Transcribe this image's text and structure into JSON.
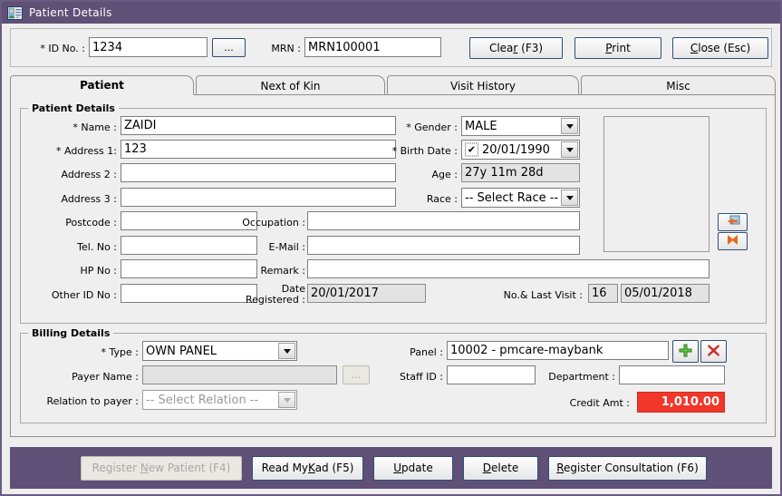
{
  "window": {
    "title": "Patient Details",
    "title_icon": "id-card-person-icon",
    "titlebar_color": "#5f5077",
    "accent_red": "#f0372a"
  },
  "header": {
    "id_no_label": "* ID No. :",
    "id_no_value": "1234",
    "browse_label": "...",
    "mrn_label": "MRN :",
    "mrn_value": "MRN100001",
    "buttons": [
      {
        "name": "clear-button",
        "label": "Clear (F3)",
        "underline": "r"
      },
      {
        "name": "print-button",
        "label": "Print",
        "underline": "P"
      },
      {
        "name": "close-button",
        "label": "Close (Esc)",
        "underline": "C"
      }
    ]
  },
  "tabs": [
    {
      "label": "Patient",
      "active": true
    },
    {
      "label": "Next of Kin",
      "active": false
    },
    {
      "label": "Visit History",
      "active": false
    },
    {
      "label": "Misc",
      "active": false
    }
  ],
  "patient_details": {
    "group_title": "Patient Details",
    "name_label": "* Name :",
    "name_value": "ZAIDI",
    "address1_label": "* Address 1:",
    "address1_value": "123",
    "address2_label": "Address 2 :",
    "address2_value": "",
    "address3_label": "Address 3 :",
    "address3_value": "",
    "postcode_label": "Postcode :",
    "postcode_value": "",
    "tel_label": "Tel. No :",
    "tel_value": "",
    "hp_label": "HP No :",
    "hp_value": "",
    "other_id_label": "Other ID No :",
    "other_id_value": "",
    "occupation_label": "Occupation :",
    "occupation_value": "",
    "email_label": "E-Mail :",
    "email_value": "",
    "remark_label": "Remark :",
    "remark_value": "",
    "date_registered_label_1": "Date",
    "date_registered_label_2": "Registered :",
    "date_registered_value": "20/01/2017",
    "gender_label": "* Gender :",
    "gender_value": "MALE",
    "birth_date_label": "* Birth Date :",
    "birth_date_value": "20/01/1990",
    "birth_date_checked": "✔",
    "age_label": "Age :",
    "age_value": "27y 11m 28d",
    "race_label": "Race :",
    "race_value": "-- Select Race --",
    "last_visit_label": "No.& Last  Visit :",
    "visit_count": "16",
    "last_visit_date": "05/01/2018",
    "photo_placeholder": "",
    "photo_load_icon": "load-photo-icon",
    "photo_clear_icon": "clear-photo-icon"
  },
  "billing_details": {
    "group_title": "Billing Details",
    "type_label": "* Type :",
    "type_value": "OWN PANEL",
    "payer_name_label": "Payer Name :",
    "payer_name_value": "",
    "payer_browse_label": "...",
    "relation_label": "Relation to payer :",
    "relation_value": "-- Select Relation --",
    "panel_label": "Panel :",
    "panel_value": "10002 - pmcare-maybank",
    "panel_add_icon": "add-plus-icon",
    "panel_remove_icon": "remove-cross-icon",
    "staff_id_label": "Staff ID :",
    "staff_id_value": "",
    "department_label": "Department :",
    "department_value": "",
    "credit_label": "Credit Amt :",
    "credit_value": "1,010.00"
  },
  "footer": {
    "buttons": [
      {
        "name": "register-new-patient-button",
        "label": "Register New Patient (F4)",
        "underline": "N",
        "disabled": true
      },
      {
        "name": "read-mykad-button",
        "label": "Read MyKad (F5)",
        "underline": "K",
        "disabled": false
      },
      {
        "name": "update-button",
        "label": "Update",
        "underline": "U",
        "disabled": false
      },
      {
        "name": "delete-button",
        "label": "Delete",
        "underline": "D",
        "disabled": false
      },
      {
        "name": "register-consultation-button",
        "label": "Register Consultation (F6)",
        "underline": "R",
        "disabled": false
      }
    ]
  }
}
